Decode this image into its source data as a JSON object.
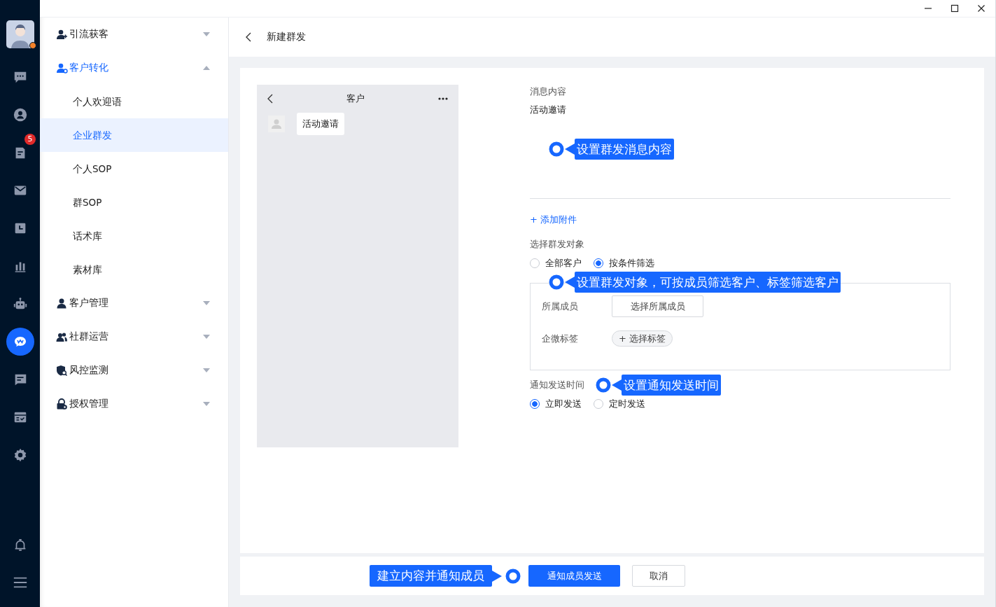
{
  "rail": {
    "items": [
      {
        "selected": false
      },
      {
        "selected": false
      },
      {
        "selected": false,
        "badge": "5"
      },
      {
        "selected": false
      },
      {
        "selected": false
      },
      {
        "selected": false
      },
      {
        "selected": false
      },
      {
        "selected": true
      },
      {
        "selected": false
      },
      {
        "selected": false
      },
      {
        "selected": false
      }
    ]
  },
  "sidebar": {
    "groups": [
      {
        "label": "引流获客",
        "expanded": false,
        "selected": false
      },
      {
        "label": "客户转化",
        "expanded": true,
        "selected": true,
        "children": [
          {
            "label": "个人欢迎语",
            "selected": false
          },
          {
            "label": "企业群发",
            "selected": true
          },
          {
            "label": "个人SOP",
            "selected": false
          },
          {
            "label": "群SOP",
            "selected": false
          },
          {
            "label": "话术库",
            "selected": false
          },
          {
            "label": "素材库",
            "selected": false
          }
        ]
      },
      {
        "label": "客户管理",
        "expanded": false,
        "selected": false
      },
      {
        "label": "社群运营",
        "expanded": false,
        "selected": false
      },
      {
        "label": "风控监测",
        "expanded": false,
        "selected": false
      },
      {
        "label": "授权管理",
        "expanded": false,
        "selected": false
      }
    ]
  },
  "header": {
    "title": "新建群发"
  },
  "preview": {
    "title": "客户",
    "message": "活动邀请"
  },
  "form": {
    "content_label": "消息内容",
    "content_value": "活动邀请",
    "content_hint": "设置群发消息内容",
    "add_attachment": "+ 添加附件",
    "target_label": "选择群发对象",
    "target_options": [
      {
        "label": "全部客户",
        "selected": false
      },
      {
        "label": "按条件筛选",
        "selected": true
      }
    ],
    "target_hint": "设置群发对象，可按成员筛选客户、标签筛选客户",
    "filters": [
      {
        "label": "所属成员",
        "kind": "button",
        "control": "选择所属成员"
      },
      {
        "label": "企微标签",
        "kind": "tag",
        "control": "+ 选择标签"
      }
    ],
    "time_label": "通知发送时间",
    "time_hint": "设置通知发送时间",
    "time_options": [
      {
        "label": "立即发送",
        "selected": true
      },
      {
        "label": "定时发送",
        "selected": false
      }
    ]
  },
  "footer": {
    "hint": "建立内容并通知成员",
    "primary": "通知成员发送",
    "cancel": "取消"
  }
}
